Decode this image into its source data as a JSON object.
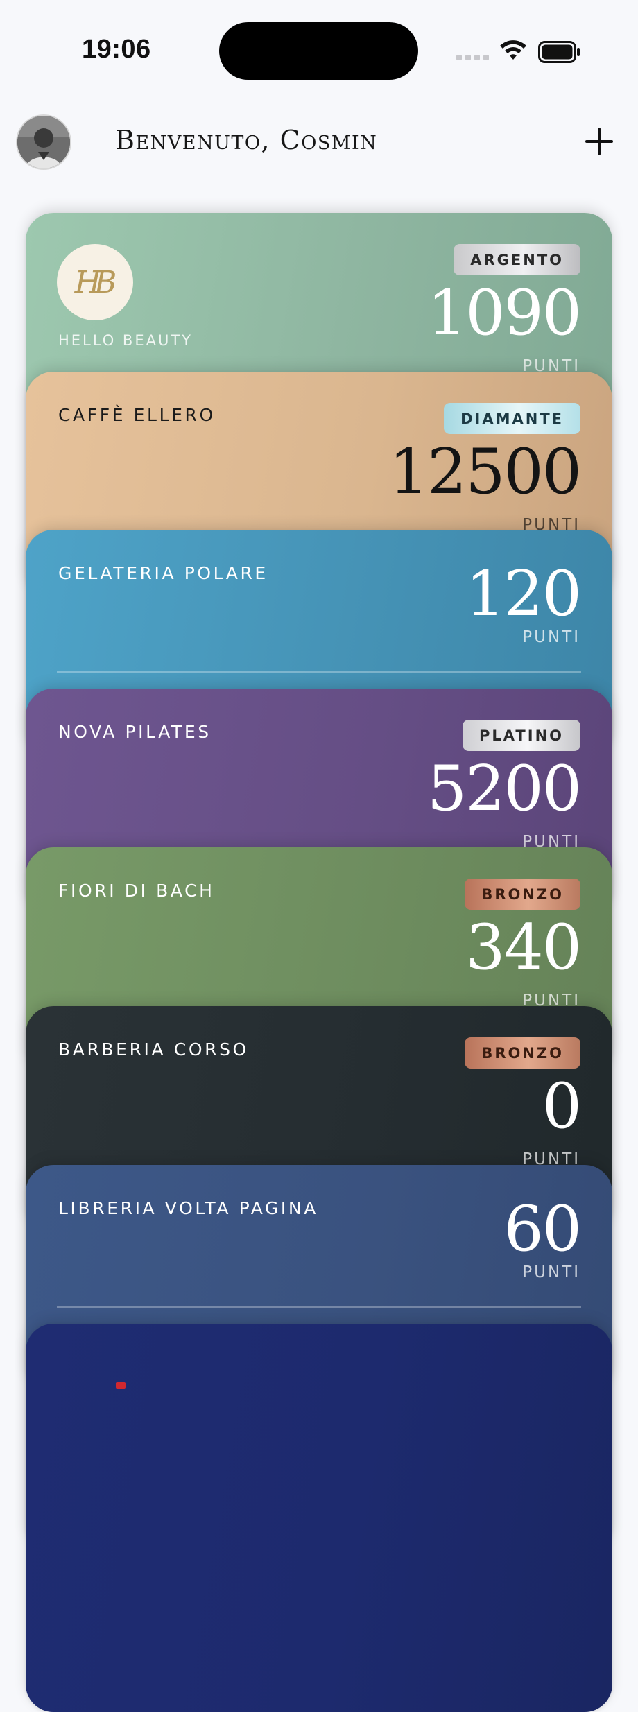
{
  "status_bar": {
    "time": "19:06"
  },
  "header": {
    "greeting": "Benvenuto, Cosmin"
  },
  "points_label": "PUNTI",
  "cards": [
    {
      "name": "HELLO BEAUTY",
      "tier": "ARGENTO",
      "points": "1090",
      "logo_text": "HB",
      "color": "#8fb9a2"
    },
    {
      "name": "CAFFÈ ELLERO",
      "tier": "DIAMANTE",
      "points": "12500",
      "color": "#d8b48d"
    },
    {
      "name": "GELATERIA POLARE",
      "points": "120",
      "color": "#4593b6"
    },
    {
      "name": "NOVA PILATES",
      "tier": "PLATINO",
      "points": "5200",
      "color": "#6a5288"
    },
    {
      "name": "FIORI DI BACH",
      "tier": "BRONZO",
      "points": "340",
      "color": "#6f8d60"
    },
    {
      "name": "BARBERIA CORSO",
      "tier": "BRONZO",
      "points": "0",
      "color": "#252d31"
    },
    {
      "name": "LIBRERIA VOLTA PAGINA",
      "points": "60",
      "color": "#3b5482"
    },
    {
      "color": "#1d2a6e"
    }
  ]
}
